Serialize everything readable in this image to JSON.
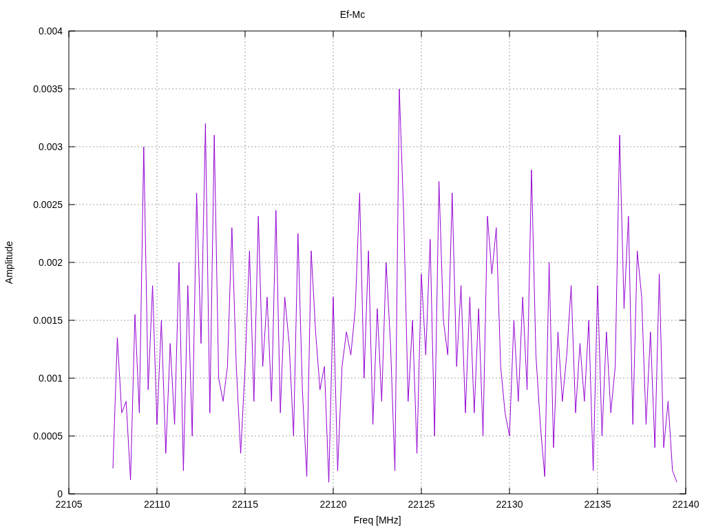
{
  "chart_data": {
    "type": "line",
    "title": "Ef-Mc",
    "xlabel": "Freq [MHz]",
    "ylabel": "Amplitude",
    "grid": true,
    "xlim": [
      22105,
      22140
    ],
    "ylim": [
      0,
      0.004
    ],
    "xticks": [
      22105,
      22110,
      22115,
      22120,
      22125,
      22130,
      22135,
      22140
    ],
    "yticks": [
      0,
      0.0005,
      0.001,
      0.0015,
      0.002,
      0.0025,
      0.003,
      0.0035,
      0.004
    ],
    "x": [
      22107.5,
      22107.75,
      22108,
      22108.25,
      22108.5,
      22108.75,
      22109,
      22109.25,
      22109.5,
      22109.75,
      22110,
      22110.25,
      22110.5,
      22110.75,
      22111,
      22111.25,
      22111.5,
      22111.75,
      22112,
      22112.25,
      22112.5,
      22112.75,
      22113,
      22113.25,
      22113.5,
      22113.75,
      22114,
      22114.25,
      22114.5,
      22114.75,
      22115,
      22115.25,
      22115.5,
      22115.75,
      22116,
      22116.25,
      22116.5,
      22116.75,
      22117,
      22117.25,
      22117.5,
      22117.75,
      22118,
      22118.25,
      22118.5,
      22118.75,
      22119,
      22119.25,
      22119.5,
      22119.75,
      22120,
      22120.25,
      22120.5,
      22120.75,
      22121,
      22121.25,
      22121.5,
      22121.75,
      22122,
      22122.25,
      22122.5,
      22122.75,
      22123,
      22123.25,
      22123.5,
      22123.75,
      22124,
      22124.25,
      22124.5,
      22124.75,
      22125,
      22125.25,
      22125.5,
      22125.75,
      22126,
      22126.25,
      22126.5,
      22126.75,
      22127,
      22127.25,
      22127.5,
      22127.75,
      22128,
      22128.25,
      22128.5,
      22128.75,
      22129,
      22129.25,
      22129.5,
      22129.75,
      22130,
      22130.25,
      22130.5,
      22130.75,
      22131,
      22131.25,
      22131.5,
      22131.75,
      22132,
      22132.25,
      22132.5,
      22132.75,
      22133,
      22133.25,
      22133.5,
      22133.75,
      22134,
      22134.25,
      22134.5,
      22134.75,
      22135,
      22135.25,
      22135.5,
      22135.75,
      22136,
      22136.25,
      22136.5,
      22136.75,
      22137,
      22137.25,
      22137.5,
      22137.75,
      22138,
      22138.25,
      22138.5,
      22138.75,
      22139,
      22139.25,
      22139.5
    ],
    "series": [
      {
        "color": "#9400d3",
        "values": [
          0.00022,
          0.00135,
          0.0007,
          0.0008,
          0.00012,
          0.00155,
          0.0007,
          0.003,
          0.0009,
          0.0018,
          0.0006,
          0.0015,
          0.00035,
          0.0013,
          0.0006,
          0.002,
          0.0002,
          0.0018,
          0.0005,
          0.0026,
          0.0013,
          0.0032,
          0.0007,
          0.0031,
          0.001,
          0.0008,
          0.0011,
          0.0023,
          0.0011,
          0.00035,
          0.0011,
          0.0021,
          0.0008,
          0.0024,
          0.0011,
          0.0017,
          0.0008,
          0.00245,
          0.0007,
          0.0017,
          0.0013,
          0.0005,
          0.00225,
          0.0009,
          0.00015,
          0.0021,
          0.0014,
          0.0009,
          0.0011,
          0.0001,
          0.0017,
          0.0002,
          0.0011,
          0.0014,
          0.0012,
          0.0016,
          0.0026,
          0.001,
          0.0021,
          0.0006,
          0.0016,
          0.0008,
          0.002,
          0.0013,
          0.0002,
          0.0035,
          0.0024,
          0.0008,
          0.0015,
          0.00035,
          0.0019,
          0.0012,
          0.0022,
          0.0005,
          0.0027,
          0.0015,
          0.0012,
          0.0026,
          0.0011,
          0.0018,
          0.0007,
          0.0017,
          0.0007,
          0.0016,
          0.0005,
          0.0024,
          0.0019,
          0.0023,
          0.0011,
          0.0007,
          0.0005,
          0.0015,
          0.0008,
          0.0017,
          0.0009,
          0.0028,
          0.0012,
          0.0006,
          0.00015,
          0.002,
          0.0004,
          0.0014,
          0.0008,
          0.0012,
          0.0018,
          0.0007,
          0.0013,
          0.0008,
          0.0015,
          0.0002,
          0.0018,
          0.0005,
          0.0014,
          0.0007,
          0.0011,
          0.0031,
          0.0016,
          0.0024,
          0.0006,
          0.0021,
          0.0017,
          0.0006,
          0.0014,
          0.0004,
          0.0019,
          0.0004,
          0.0008,
          0.0002,
          0.0001
        ]
      }
    ]
  }
}
